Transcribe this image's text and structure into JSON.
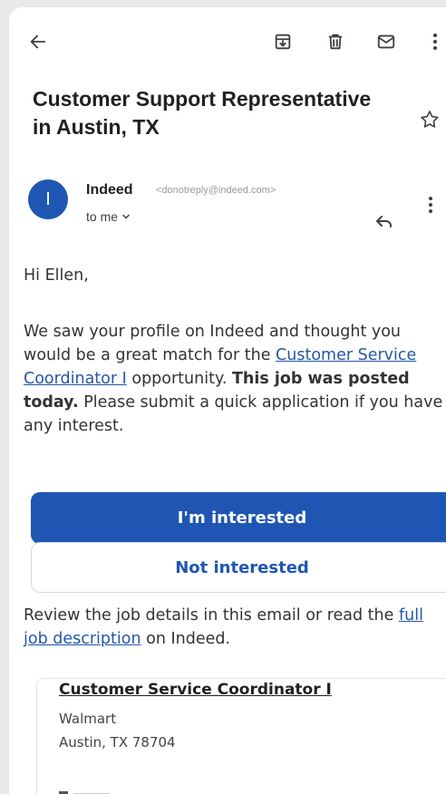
{
  "email": {
    "subject": "Customer Support Representative in Austin, TX",
    "sender_name": "Indeed",
    "sender_email": "<donotreply@indeed.com>",
    "recipient": "to me",
    "avatar_letter": "I"
  },
  "body": {
    "greeting": "Hi Ellen,",
    "para_1": "We saw your profile on Indeed and thought you would be a great match for the ",
    "job_link": "Customer Service Coordinator I",
    "para_2": " opportunity. ",
    "para_bold": "This job was posted today.",
    "para_3": " Please submit a quick application if you have any interest.",
    "interested_label": "I'm interested",
    "not_interested_label": "Not interested",
    "review_1": "Review the job details in this email or read the ",
    "review_link": "full job description",
    "review_2": " on Indeed."
  },
  "job": {
    "title": "Customer Service Coordinator I",
    "company": "Walmart",
    "location": "Austin, TX 78704"
  },
  "icons": {
    "back": "back-arrow-icon",
    "archive": "archive-icon",
    "delete": "trash-icon",
    "mark_unread": "mail-icon",
    "more": "more-vert-icon",
    "star": "star-icon",
    "reply": "reply-icon"
  },
  "colors": {
    "accent": "#1f56b3",
    "link": "#2557a7"
  }
}
